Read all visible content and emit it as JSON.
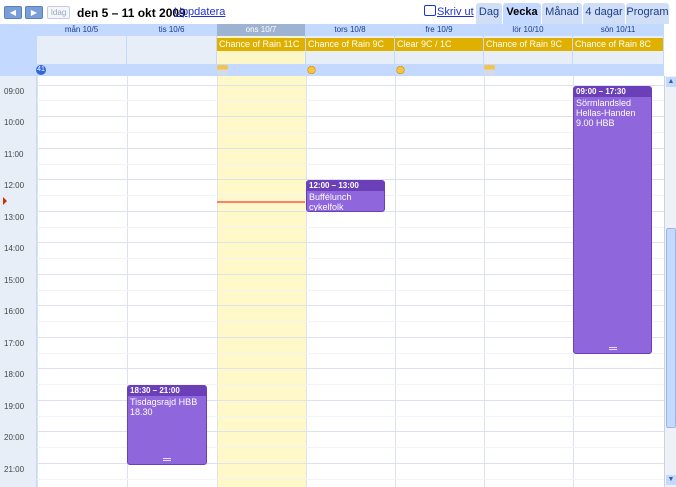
{
  "toolbar": {
    "prev_icon": "◀",
    "next_icon": "▶",
    "today_label": "Idag",
    "date_range": "den 5 – 11 okt 2009",
    "refresh_label": "Uppdatera",
    "print_label": "Skriv ut"
  },
  "view_tabs": [
    "Dag",
    "Vecka",
    "Månad",
    "4 dagar",
    "Program"
  ],
  "active_view": "Vecka",
  "week_number": "41",
  "days": [
    {
      "label": "mån 10/5",
      "weather": "",
      "today": false
    },
    {
      "label": "tis 10/6",
      "weather": "",
      "today": false
    },
    {
      "label": "ons 10/7",
      "weather": "Chance of Rain 11C",
      "today": true,
      "icon": "cloud"
    },
    {
      "label": "tors 10/8",
      "weather": "Chance of Rain 9C",
      "today": false,
      "icon": "sun"
    },
    {
      "label": "fre 10/9",
      "weather": "Clear 9C / 1C",
      "today": false,
      "icon": "sun"
    },
    {
      "label": "lör 10/10",
      "weather": "Chance of Rain 9C",
      "today": false,
      "icon": "cloud"
    },
    {
      "label": "sön 10/11",
      "weather": "Chance of Rain 8C",
      "today": false
    }
  ],
  "times": [
    "09:00",
    "10:00",
    "11:00",
    "12:00",
    "13:00",
    "14:00",
    "15:00",
    "16:00",
    "17:00",
    "18:00",
    "19:00",
    "20:00",
    "21:00"
  ],
  "events": [
    {
      "time": "12:00 – 13:00",
      "title": "Buffélunch cykelfolk"
    },
    {
      "time": "09:00 – 17:30",
      "title": "Sörmlandsled Hellas-Handen 9.00 HBB"
    },
    {
      "time": "18:30 – 21:00",
      "title": "Tisdagsrajd HBB 18.30"
    }
  ],
  "colors": {
    "header": "#c3d9ff",
    "today_col": "#fff9c9",
    "weather_bar": "#e0b000",
    "event": "#8f66db"
  }
}
